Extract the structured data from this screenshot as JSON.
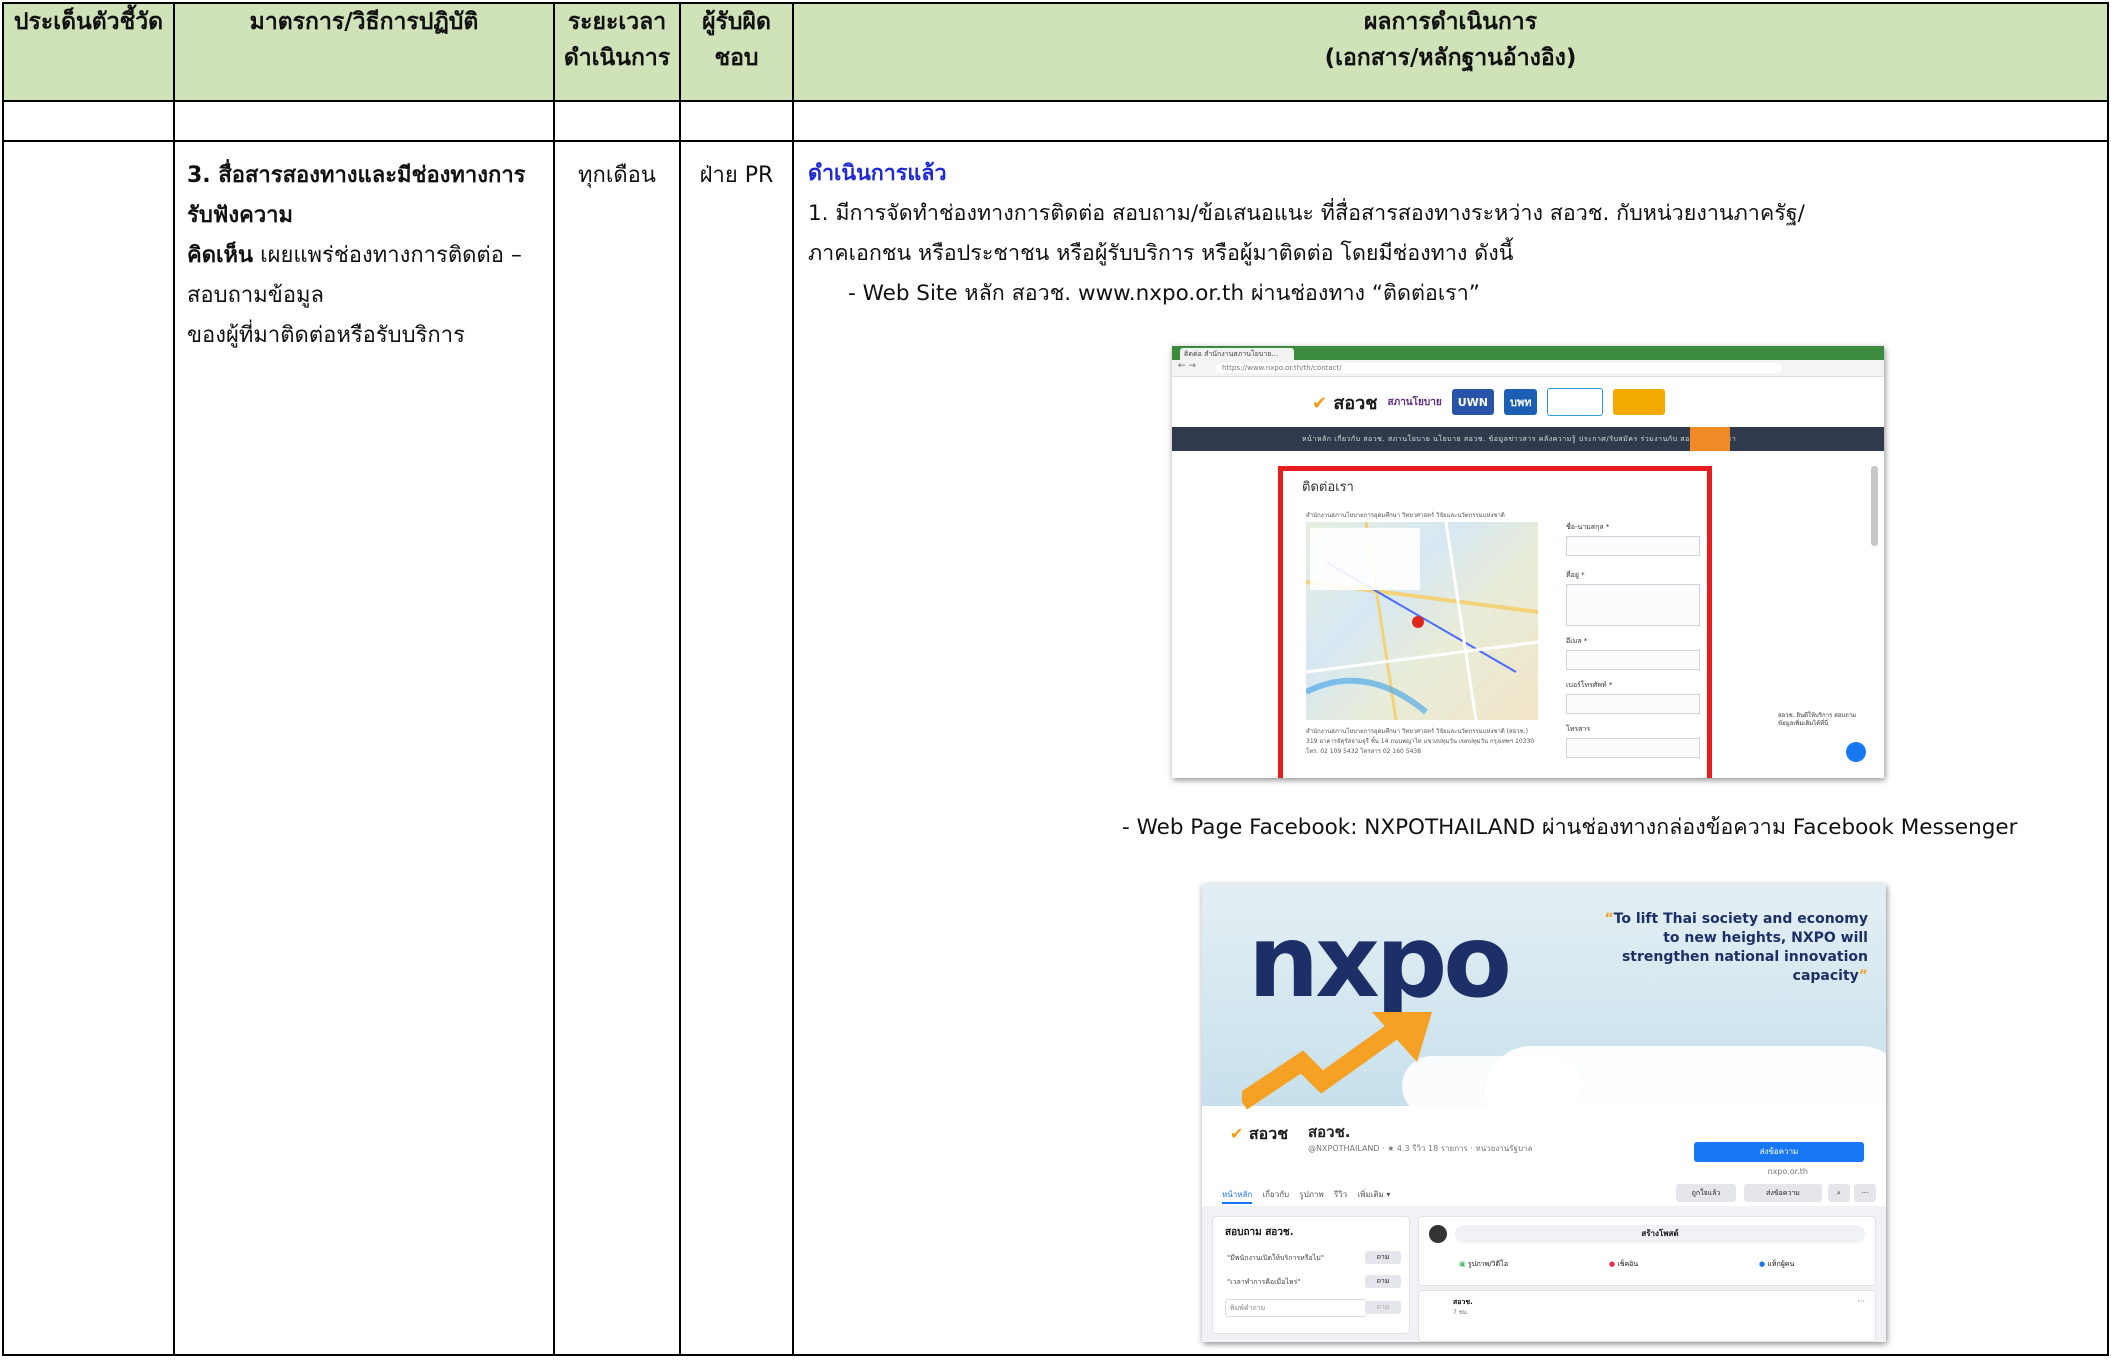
{
  "table": {
    "headers": {
      "indicator": "ประเด็นตัวชี้วัด",
      "measure": "มาตรการ/วิธีการปฏิบัติ",
      "period_line1": "ระยะเวลา",
      "period_line2": "ดำเนินการ",
      "owner": "ผู้รับผิดชอบ",
      "result_line1": "ผลการดำเนินการ",
      "result_line2": "(เอกสาร/หลักฐานอ้างอิง)"
    },
    "row": {
      "measure_bold_1": "3. สื่อสารสองทางและมีช่องทางการรับฟังความ",
      "measure_bold_2": "คิดเห็น",
      "measure_text_2": " เผยแพร่ช่องทางการติดต่อ – สอบถามข้อมูล",
      "measure_text_3": "ของผู้ที่มาติดต่อหรือรับบริการ",
      "period": "ทุกเดือน",
      "owner": "ฝ่าย PR",
      "status": "ดำเนินการแล้ว",
      "detail_line1": "1. มีการจัดทำช่องทางการติดต่อ สอบถาม/ข้อเสนอแนะ ที่สื่อสารสองทางระหว่าง สอวช. กับหน่วยงานภาครัฐ/",
      "detail_line2": "ภาคเอกชน หรือประชาชน หรือผู้รับบริการ หรือผู้มาติดต่อ โดยมีช่องทาง ดังนี้",
      "bullet1": "- Web Site หลัก สอวช. www.nxpo.or.th ผ่านช่องทาง “ติดต่อเรา”",
      "bullet2": "- Web Page Facebook: NXPOTHAILAND ผ่านช่องทางกล่องข้อความ Facebook Messenger"
    }
  },
  "screenshot_website": {
    "tab_title": "ติดต่อ สำนักงานสภานโยบาย...",
    "url": "https://www.nxpo.or.th/th/contact/",
    "logo_text": "สอวช",
    "logo_2": "สภานโยบาย",
    "logo_3": "UWN",
    "logo_4": "บพท",
    "nav_text": "หน้าหลัก   เกี่ยวกับ สอวช.   สภานโยบาย   นโยบาย สอวช.   ข้อมูลข่าวสาร   คลังความรู้   ประกาศ/รับสมัคร   ร่วมงานกับ สอวช.   ติดต่อเรา",
    "page_title": "ติดต่อเรา",
    "map_caption": "สำนักงานสภานโยบายการอุดมศึกษา วิทยาศาสตร์ วิจัยและนวัตกรรมแห่งชาติ",
    "address_1": "สำนักงานสภานโยบายการอุดมศึกษา วิทยาศาสตร์ วิจัยและนวัตกรรมแห่งชาติ (สอวช.)",
    "address_2": "319 อาคารจัตุรัสจามจุรี ชั้น 14 ถนนพญาไท แขวงปทุมวัน เขตปทุมวัน กรุงเทพฯ 10330",
    "address_3": "โทร. 02 109 5432 โทรสาร 02 160 5438",
    "form_labels": [
      "ชื่อ-นามสกุล *",
      "ที่อยู่ *",
      "อีเมล *",
      "เบอร์โทรศัพท์ *",
      "โทรสาร"
    ],
    "chat_text": "สอวช. ยินดีให้บริการ สอบถามข้อมูลเพิ่มเติมได้ที่นี่"
  },
  "screenshot_facebook": {
    "cover_logo": "nxpo",
    "quote_open": "“",
    "quote_text": "To lift Thai society and economy to new heights, NXPO will strengthen national innovation capacity",
    "quote_close": "”",
    "logo_text": "สอวช",
    "page_name": "สอวช.",
    "page_sub": "@NXPOTHAILAND · ★ 4.3 รีวิว 18 รายการ · หน่วยงานรัฐบาล",
    "primary_button": "ส่งข้อความ",
    "website": "nxpo.or.th",
    "tabs": [
      "หน้าหลัก",
      "เกี่ยวกับ",
      "รูปภาพ",
      "รีวิว",
      "เพิ่มเติม ▾"
    ],
    "action_like": "ถูกใจแล้ว",
    "action_message": "ส่งข้อความ",
    "ask_title": "สอบถาม สอวช.",
    "ask_q1": "\"มีพนักงานเปิดให้บริการหรือไม่\"",
    "ask_q2": "\"เวลาทำการคือเมื่อไหร่\"",
    "ask_button": "ถาม",
    "ask_placeholder": "พิมพ์คำถาม",
    "create_post": "สร้างโพสต์",
    "post_photo": "รูปภาพ/วิดีโอ",
    "post_checkin": "เช็คอิน",
    "post_tag": "แท็กผู้คน",
    "post_author": "สอวช.",
    "post_time": "7 ชม."
  },
  "colors": {
    "header_bg": "#cfe2b8",
    "status_blue": "#1f2bd0",
    "highlight_red": "#e81c1c",
    "facebook_blue": "#1877f2",
    "nxpo_navy": "#1c2f66",
    "nxpo_orange": "#f4a124"
  }
}
